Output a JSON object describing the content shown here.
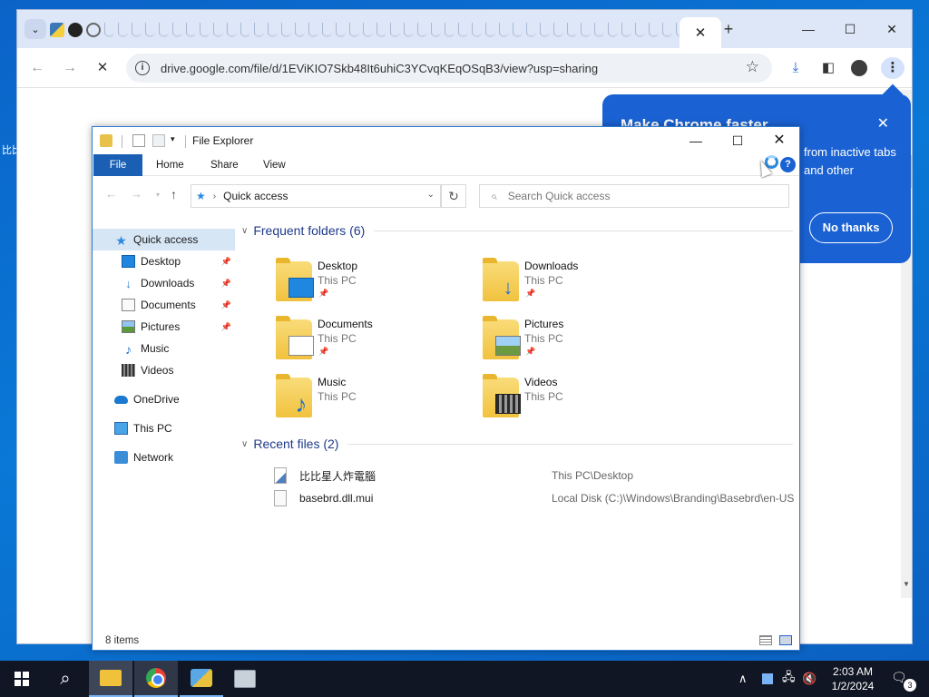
{
  "desktop": {
    "side_label": "比比"
  },
  "chrome": {
    "new_tab": "+",
    "tab_close": "✕",
    "url": "drive.google.com/file/d/1EViKIO7Skb48It6uhiC3YCvqKEqOSqB3/view?usp=sharing",
    "window_controls": {
      "minimize": "—",
      "maximize": "☐",
      "close": "✕"
    },
    "nav": {
      "back": "←",
      "forward": "→",
      "stop": "✕"
    }
  },
  "promo": {
    "title": "Make Chrome faster",
    "body": "from inactive tabs and other",
    "no_thanks": "No thanks",
    "close": "✕"
  },
  "explorer": {
    "title": "File Explorer",
    "ribbon": {
      "file": "File",
      "home": "Home",
      "share": "Share",
      "view": "View",
      "help": "?"
    },
    "address": {
      "location": "Quick access",
      "search_placeholder": "Search Quick access"
    },
    "nav_pane": [
      {
        "label": "Quick access",
        "icon": "star-icon",
        "pinned": false
      },
      {
        "label": "Desktop",
        "icon": "desktop-icon",
        "pinned": true
      },
      {
        "label": "Downloads",
        "icon": "downloads-icon",
        "pinned": true
      },
      {
        "label": "Documents",
        "icon": "documents-icon",
        "pinned": true
      },
      {
        "label": "Pictures",
        "icon": "pictures-icon",
        "pinned": true
      },
      {
        "label": "Music",
        "icon": "music-icon",
        "pinned": false
      },
      {
        "label": "Videos",
        "icon": "videos-icon",
        "pinned": false
      },
      {
        "label": "OneDrive",
        "icon": "onedrive-icon",
        "pinned": false
      },
      {
        "label": "This PC",
        "icon": "this-pc-icon",
        "pinned": false
      },
      {
        "label": "Network",
        "icon": "network-icon",
        "pinned": false
      }
    ],
    "frequent_header": "Frequent folders (6)",
    "frequent": [
      {
        "name": "Desktop",
        "location": "This PC",
        "pinned": true
      },
      {
        "name": "Downloads",
        "location": "This PC",
        "pinned": true
      },
      {
        "name": "Documents",
        "location": "This PC",
        "pinned": true
      },
      {
        "name": "Pictures",
        "location": "This PC",
        "pinned": true
      },
      {
        "name": "Music",
        "location": "This PC",
        "pinned": false
      },
      {
        "name": "Videos",
        "location": "This PC",
        "pinned": false
      }
    ],
    "recent_header": "Recent files (2)",
    "recent": [
      {
        "name": "比比星人炸電腦",
        "path": "This PC\\Desktop"
      },
      {
        "name": "basebrd.dll.mui",
        "path": "Local Disk (C:)\\Windows\\Branding\\Basebrd\\en-US"
      }
    ],
    "status": "8 items"
  },
  "taskbar": {
    "time": "2:03 AM",
    "date": "1/2/2024",
    "notification_count": "3"
  }
}
